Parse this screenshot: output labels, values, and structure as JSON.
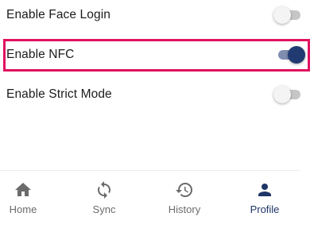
{
  "settings": [
    {
      "label": "Enable Face Login",
      "enabled": false
    },
    {
      "label": "Enable NFC",
      "enabled": true
    },
    {
      "label": "Enable Strict Mode",
      "enabled": false
    }
  ],
  "nav": {
    "items": [
      {
        "label": "Home",
        "icon": "home-icon"
      },
      {
        "label": "Sync",
        "icon": "sync-icon"
      },
      {
        "label": "History",
        "icon": "history-icon"
      },
      {
        "label": "Profile",
        "icon": "person-icon",
        "active": true
      }
    ]
  },
  "colors": {
    "accent": "#213b72",
    "highlight": "#e0115f",
    "inactive_icon": "#6b6b6b"
  }
}
